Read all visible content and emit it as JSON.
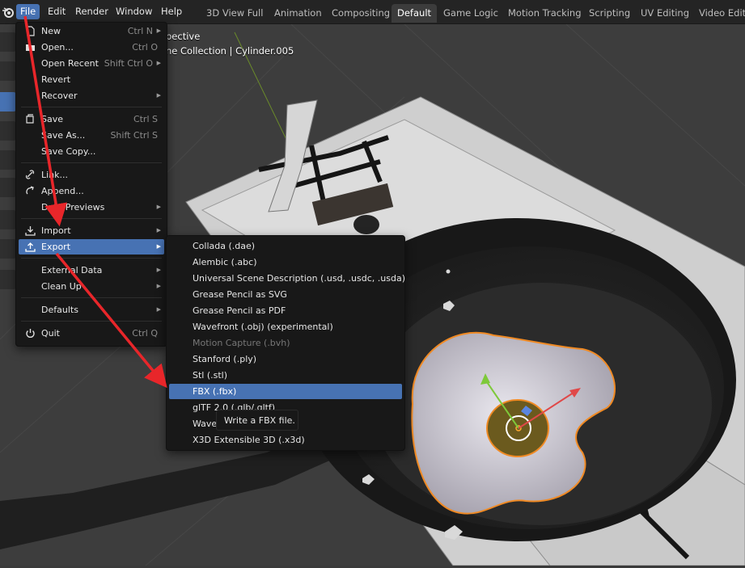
{
  "menubar": {
    "items": [
      "File",
      "Edit",
      "Render",
      "Window",
      "Help"
    ],
    "active": "File"
  },
  "workspaces": {
    "tabs": [
      "3D View Full",
      "Animation",
      "Compositing",
      "Default",
      "Game Logic",
      "Motion Tracking",
      "Scripting",
      "UV Editing",
      "Video Editi"
    ],
    "active": "Default"
  },
  "viewport": {
    "view_name": "pective",
    "collection_info": "ne Collection | Cylinder.005"
  },
  "file_menu": {
    "items": [
      {
        "label": "New",
        "shortcut": "Ctrl N",
        "submenu": true,
        "icon": "new-file-icon"
      },
      {
        "label": "Open...",
        "shortcut": "Ctrl O",
        "submenu": false,
        "icon": "folder-icon"
      },
      {
        "label": "Open Recent",
        "shortcut": "Shift Ctrl O",
        "submenu": true,
        "icon": ""
      },
      {
        "label": "Revert",
        "shortcut": "",
        "submenu": false,
        "icon": ""
      },
      {
        "label": "Recover",
        "shortcut": "",
        "submenu": true,
        "icon": ""
      },
      {
        "label": "Save",
        "shortcut": "Ctrl S",
        "submenu": false,
        "icon": "save-icon"
      },
      {
        "label": "Save As...",
        "shortcut": "Shift Ctrl S",
        "submenu": false,
        "icon": ""
      },
      {
        "label": "Save Copy...",
        "shortcut": "",
        "submenu": false,
        "icon": ""
      },
      {
        "label": "Link...",
        "shortcut": "",
        "submenu": false,
        "icon": "link-icon"
      },
      {
        "label": "Append...",
        "shortcut": "",
        "submenu": false,
        "icon": "append-icon"
      },
      {
        "label": "Data Previews",
        "shortcut": "",
        "submenu": true,
        "icon": ""
      },
      {
        "label": "Import",
        "shortcut": "",
        "submenu": true,
        "icon": "import-icon"
      },
      {
        "label": "Export",
        "shortcut": "",
        "submenu": true,
        "icon": "export-icon"
      },
      {
        "label": "External Data",
        "shortcut": "",
        "submenu": true,
        "icon": ""
      },
      {
        "label": "Clean Up",
        "shortcut": "",
        "submenu": true,
        "icon": ""
      },
      {
        "label": "Defaults",
        "shortcut": "",
        "submenu": true,
        "icon": ""
      },
      {
        "label": "Quit",
        "shortcut": "Ctrl Q",
        "submenu": false,
        "icon": "power-icon"
      }
    ],
    "highlighted": "Export"
  },
  "export_menu": {
    "items": [
      {
        "label": "Collada (.dae)",
        "disabled": false
      },
      {
        "label": "Alembic (.abc)",
        "disabled": false
      },
      {
        "label": "Universal Scene Description (.usd, .usdc, .usda)",
        "disabled": false
      },
      {
        "label": "Grease Pencil as SVG",
        "disabled": false
      },
      {
        "label": "Grease Pencil as PDF",
        "disabled": false
      },
      {
        "label": "Wavefront (.obj) (experimental)",
        "disabled": false
      },
      {
        "label": "Motion Capture (.bvh)",
        "disabled": true
      },
      {
        "label": "Stanford (.ply)",
        "disabled": false
      },
      {
        "label": "Stl (.stl)",
        "disabled": false
      },
      {
        "label": "FBX (.fbx)",
        "disabled": false
      },
      {
        "label": "glTF 2.0 (.glb/.gltf)",
        "disabled": false
      },
      {
        "label": "Wave",
        "disabled": false
      },
      {
        "label": "X3D Extensible 3D (.x3d)",
        "disabled": false
      }
    ],
    "highlighted": "FBX (.fbx)"
  },
  "tooltip": {
    "text": "Write a FBX file."
  },
  "colors": {
    "accent": "#4772b3",
    "menu_bg": "#181818",
    "annotation_arrow": "#e8262a",
    "selection_outline": "#f08a24"
  }
}
